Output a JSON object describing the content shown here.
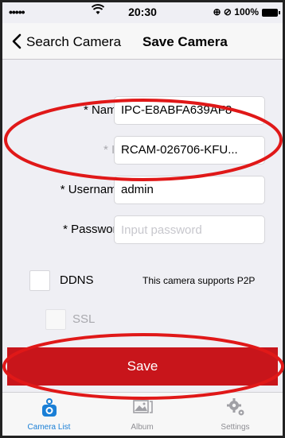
{
  "status_bar": {
    "signal": "•••••",
    "time": "20:30",
    "right_indicators": "⊕ ⊘ 100%"
  },
  "nav": {
    "back_label": "Search Camera",
    "title": "Save Camera"
  },
  "form": {
    "name": {
      "label": "* Name",
      "value": "IPC-E8ABFA639AF8"
    },
    "id": {
      "label": "* ID",
      "value": "RCAM-026706-KFU..."
    },
    "username": {
      "label": "* Username",
      "value": "admin"
    },
    "password": {
      "label": "* Password",
      "placeholder": "Input password"
    },
    "ddns": {
      "label": "DDNS",
      "note": "This camera supports P2P",
      "checked": false
    },
    "ssl": {
      "label": "SSL",
      "checked": false
    }
  },
  "save_button": {
    "label": "Save"
  },
  "tab_bar": {
    "items": [
      {
        "label": "Camera List",
        "icon": "camera-icon",
        "active": true
      },
      {
        "label": "Album",
        "icon": "album-icon",
        "active": false
      },
      {
        "label": "Settings",
        "icon": "gear-icon",
        "active": false
      }
    ]
  },
  "colors": {
    "accent_red": "#c8151b",
    "tab_active_blue": "#1a7fd6",
    "annotation_red": "#e01818"
  }
}
